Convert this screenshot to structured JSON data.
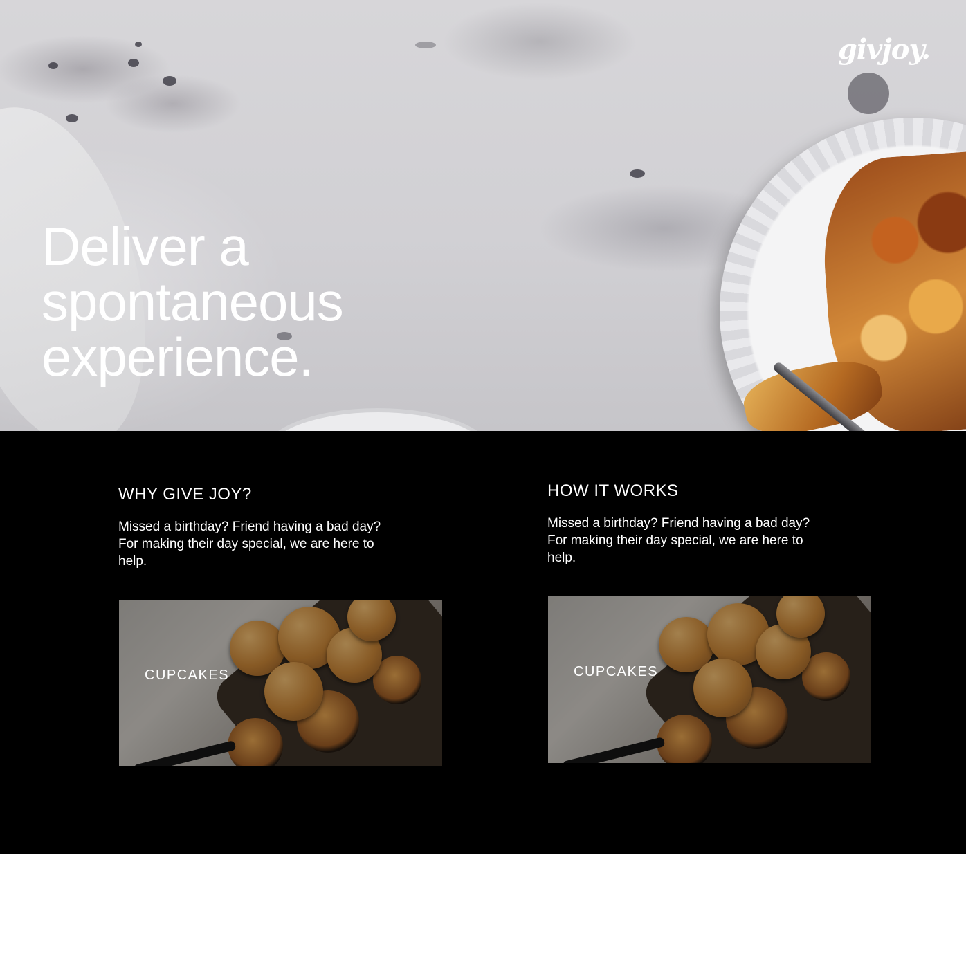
{
  "brand": {
    "logo_text": "givjoy."
  },
  "hero": {
    "title_line1": "Deliver a",
    "title_line2": "spontaneous",
    "title_line3": "experience."
  },
  "sections": [
    {
      "heading": "WHY GIVE JOY?",
      "body": "Missed a birthday? Friend having a bad day? For making their day special, we are here to help.",
      "card_label": "CUPCAKES"
    },
    {
      "heading": "HOW IT WORKS",
      "body": "Missed a birthday? Friend having a bad day? For making their day special, we are here to help.",
      "card_label": "CUPCAKES"
    }
  ],
  "colors": {
    "dark_section": "#000000",
    "text_light": "#ffffff"
  }
}
